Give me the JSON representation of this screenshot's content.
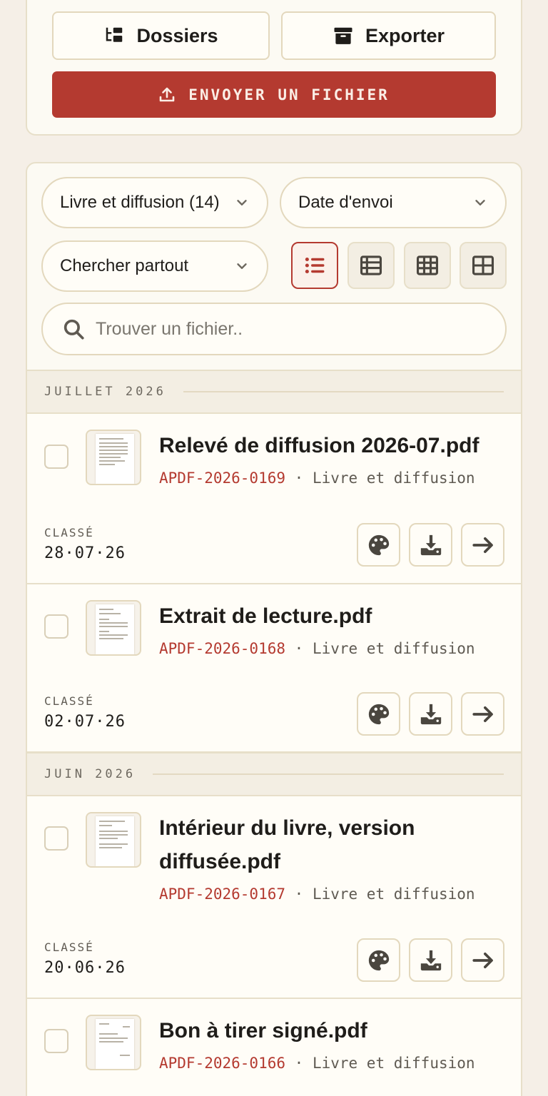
{
  "toolbar": {
    "dossiers_label": "Dossiers",
    "exporter_label": "Exporter",
    "upload_label": "ENVOYER UN FICHIER"
  },
  "filters": {
    "category": "Livre et diffusion (14)",
    "sort": "Date d'envoi",
    "scope": "Chercher partout"
  },
  "view_modes": [
    "list-icon",
    "table-icon",
    "grid-small-icon",
    "grid-large-icon"
  ],
  "active_view": "list",
  "search": {
    "placeholder": "Trouver un fichier.."
  },
  "groups": [
    {
      "label": "JUILLET 2026"
    },
    {
      "label": "JUIN 2026"
    }
  ],
  "files": [
    {
      "title": "Relevé de diffusion 2026-07.pdf",
      "ref": "APDF-2026-0169",
      "category": "Livre et diffusion",
      "status": "CLASSÉ",
      "date": "28·07·26"
    },
    {
      "title": "Extrait de lecture.pdf",
      "ref": "APDF-2026-0168",
      "category": "Livre et diffusion",
      "status": "CLASSÉ",
      "date": "02·07·26"
    },
    {
      "title": "Intérieur du livre, version diffusée.pdf",
      "ref": "APDF-2026-0167",
      "category": "Livre et diffusion",
      "status": "CLASSÉ",
      "date": "20·06·26"
    },
    {
      "title": "Bon à tirer signé.pdf",
      "ref": "APDF-2026-0166",
      "category": "Livre et diffusion",
      "status": "",
      "date": ""
    }
  ],
  "meta_separator": " · ",
  "colors": {
    "accent": "#b43a30",
    "background": "#f5efe7",
    "card": "#fffdf7",
    "border": "#e3d8bd"
  }
}
